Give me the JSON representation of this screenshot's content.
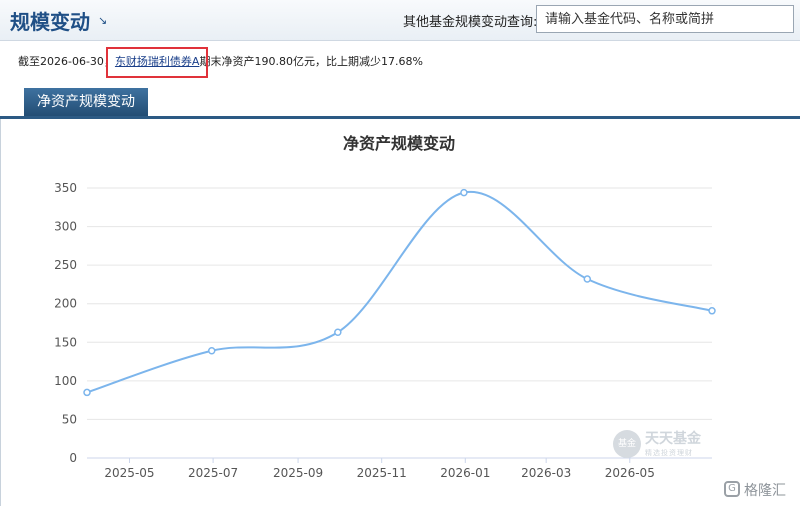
{
  "header": {
    "title": "规模变动",
    "title_arrow": "↘",
    "search_label": "其他基金规模变动查询:",
    "search_placeholder": "请输入基金代码、名称或简拼"
  },
  "info": {
    "prefix": "截至2026-06-30，",
    "fund_name": "东财扬瑞利债券A",
    "suffix": "期末净资产190.80亿元，比上期减少17.68%"
  },
  "tabs": [
    {
      "label": "净资产规模变动",
      "active": true
    }
  ],
  "watermark": {
    "title": "天天基金",
    "subtitle": "精选投资理财",
    "badge": "基金"
  },
  "corner_mark": {
    "text": "格隆汇"
  },
  "colors": {
    "line": "#7cb5ec",
    "brand": "#1f4f86",
    "highlight": "#e0323a"
  },
  "chart_data": {
    "type": "line",
    "title": "净资产规模变动",
    "ylim": [
      0,
      350
    ],
    "yticks": [
      0,
      50,
      100,
      150,
      200,
      250,
      300,
      350
    ],
    "xlim": [
      "2025-03-31",
      "2026-06-30"
    ],
    "xticks": [
      "2025-05",
      "2025-07",
      "2025-09",
      "2025-11",
      "2026-01",
      "2026-03",
      "2026-05"
    ],
    "series": [
      {
        "x": [
          "2025-03-31",
          "2025-06-30",
          "2025-09-30",
          "2025-12-31",
          "2026-03-31",
          "2026-06-30"
        ],
        "values": [
          85,
          139,
          163,
          344,
          232,
          190.8
        ]
      }
    ],
    "grid": true
  }
}
